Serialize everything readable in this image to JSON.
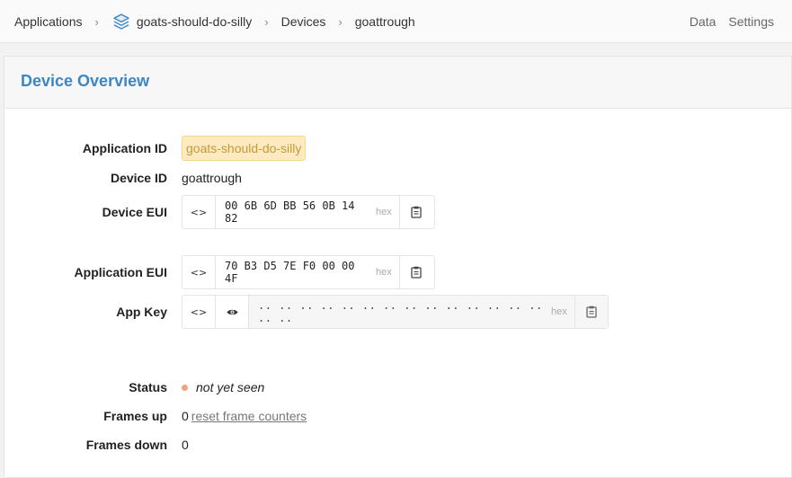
{
  "breadcrumbs": {
    "applications": "Applications",
    "application": "goats-should-do-silly",
    "devices": "Devices",
    "device": "goattrough",
    "separator": ">"
  },
  "top_nav": {
    "data": "Data",
    "settings": "Settings"
  },
  "card": {
    "title": "Device Overview"
  },
  "overview": {
    "application_id": {
      "label": "Application ID",
      "value": "goats-should-do-silly"
    },
    "device_id": {
      "label": "Device ID",
      "value": "goattrough"
    },
    "device_eui": {
      "label": "Device EUI",
      "toggle": "<>",
      "value": "00 6B 6D BB 56 0B 14 82",
      "format": "hex"
    },
    "application_eui": {
      "label": "Application EUI",
      "toggle": "<>",
      "value": "70 B3 D5 7E F0 00 00 4F",
      "format": "hex"
    },
    "app_key": {
      "label": "App Key",
      "toggle": "<>",
      "value": ".. .. .. .. .. .. .. .. .. .. .. .. .. .. .. ..",
      "format": "hex"
    },
    "status": {
      "label": "Status",
      "value": "not yet seen"
    },
    "frames_up": {
      "label": "Frames up",
      "value": "0",
      "link": "reset frame counters"
    },
    "frames_down": {
      "label": "Frames down",
      "value": "0"
    }
  },
  "icons": {
    "application": "stack-layers-icon",
    "toggle": "code-brackets-icon",
    "reveal": "eye-icon",
    "copy": "clipboard-icon"
  },
  "colors": {
    "accent": "#3d86c6",
    "badge_bg": "#fdeac0",
    "badge_text": "#c49a3a",
    "status_dot": "#f3a07b"
  }
}
